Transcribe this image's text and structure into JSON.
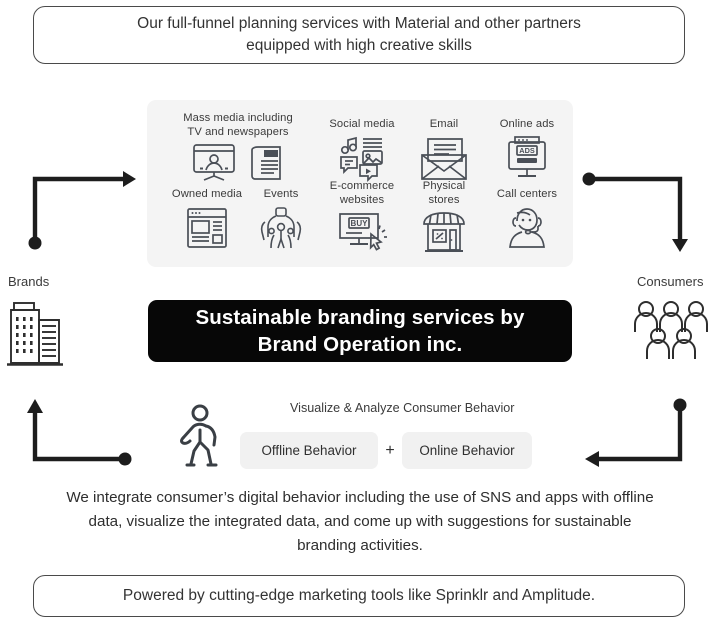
{
  "top_banner": {
    "line1": "Our full-funnel planning services with Material and other partners",
    "line2": "equipped with high creative skills"
  },
  "channels_panel": {
    "items": [
      {
        "id": "mass-media",
        "label": "Mass media including\nTV and newspapers",
        "icons": [
          "tv-icon",
          "newspaper-icon"
        ]
      },
      {
        "id": "social-media",
        "label": "Social media",
        "icons": [
          "social-media-icon"
        ]
      },
      {
        "id": "email",
        "label": "Email",
        "icons": [
          "envelope-icon"
        ]
      },
      {
        "id": "online-ads",
        "label": "Online ads",
        "icons": [
          "online-ads-monitor-icon"
        ]
      },
      {
        "id": "owned-media",
        "label": "Owned media",
        "icons": [
          "website-layout-icon"
        ]
      },
      {
        "id": "events",
        "label": "Events",
        "icons": [
          "events-crowd-icon"
        ]
      },
      {
        "id": "ecommerce-websites",
        "label": "E-commerce\nwebsites",
        "icons": [
          "ecommerce-buy-monitor-icon"
        ]
      },
      {
        "id": "physical-stores",
        "label": "Physical\nstores",
        "icons": [
          "storefront-icon"
        ]
      },
      {
        "id": "call-centers",
        "label": "Call centers",
        "icons": [
          "headset-agent-icon"
        ]
      }
    ]
  },
  "center_banner": {
    "line1": "Sustainable branding services by",
    "line2": "Brand Operation inc."
  },
  "sides": {
    "brands_label": "Brands",
    "brands_icon": "office-buildings-icon",
    "consumers_label": "Consumers",
    "consumers_icon": "people-group-icon"
  },
  "behavior": {
    "title": "Visualize & Analyze Consumer Behavior",
    "walker_icon": "walking-person-icon",
    "offline_chip": "Offline Behavior",
    "plus": "+",
    "online_chip": "Online Behavior"
  },
  "summary": {
    "line1": "We integrate consumer’s digital behavior including the use of SNS and",
    "line2": "apps with offline data, visualize the integrated data, and come up with",
    "line3": "suggestions for sustainable branding activities."
  },
  "bottom_banner": {
    "text": "Powered by cutting-edge marketing tools like Sprinklr and Amplitude."
  },
  "arrows": {
    "top_left": "arrow-brands-to-channels",
    "top_right": "arrow-channels-to-consumers",
    "bottom_left": "arrow-behavior-to-brands",
    "bottom_right": "arrow-consumers-to-behavior"
  },
  "colors": {
    "panel_bg": "#f4f4f4",
    "chip_bg": "#f1f1f1",
    "banner_bg": "#070707",
    "icon_stroke": "#4a4f57",
    "outline": "#4a4a4a"
  }
}
